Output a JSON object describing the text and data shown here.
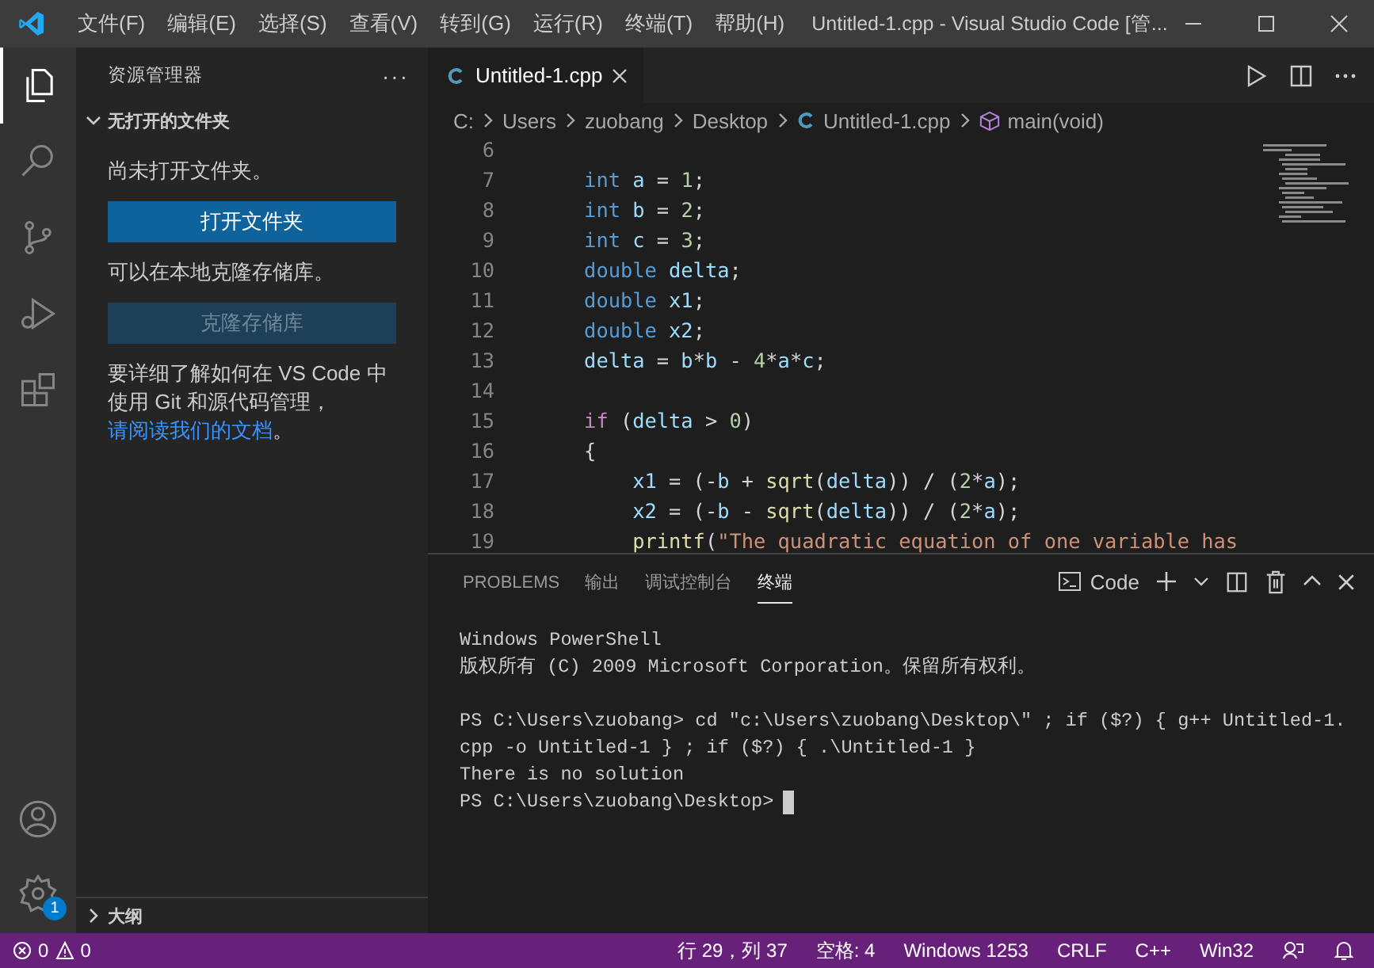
{
  "title_bar": {
    "menus": [
      "文件(F)",
      "编辑(E)",
      "选择(S)",
      "查看(V)",
      "转到(G)",
      "运行(R)",
      "终端(T)",
      "帮助(H)"
    ],
    "title": "Untitled-1.cpp - Visual Studio Code [管..."
  },
  "activity_bar": {
    "items": [
      {
        "kind": "explorer",
        "selected": true
      },
      {
        "kind": "search",
        "selected": false
      },
      {
        "kind": "scm",
        "selected": false
      },
      {
        "kind": "debug",
        "selected": false
      },
      {
        "kind": "extensions",
        "selected": false
      }
    ],
    "settings_badge": "1"
  },
  "sidebar": {
    "title": "资源管理器",
    "more": "···",
    "section": "无打开的文件夹",
    "no_folder_text": "尚未打开文件夹。",
    "open_button": "打开文件夹",
    "clone_text": "可以在本地克隆存储库。",
    "clone_button": {
      "label": "克隆存储库",
      "disabled": true
    },
    "learn_text": "要详细了解如何在 VS Code 中使用 Git 和源代码管理，",
    "learn_link": "请阅读我们的文档",
    "learn_end": "。",
    "outline": "大纲"
  },
  "editor": {
    "tab": {
      "label": "Untitled-1.cpp",
      "selected": true
    },
    "breadcrumb": [
      "C:",
      "Users",
      "zuobang",
      "Desktop",
      "Untitled-1.cpp",
      "main(void)"
    ],
    "lines": [
      {
        "number": "6"
      },
      {
        "number": "7",
        "tokens": [
          {
            "kind": "type",
            "text": "    int"
          },
          {
            "kind": "var",
            "text": " a"
          },
          {
            "kind": "plain",
            "text": " = "
          },
          {
            "kind": "num",
            "text": "1"
          },
          {
            "kind": "plain",
            "text": ";"
          }
        ]
      },
      {
        "number": "8",
        "tokens": [
          {
            "kind": "type",
            "text": "    int"
          },
          {
            "kind": "var",
            "text": " b"
          },
          {
            "kind": "plain",
            "text": " = "
          },
          {
            "kind": "num",
            "text": "2"
          },
          {
            "kind": "plain",
            "text": ";"
          }
        ]
      },
      {
        "number": "9",
        "tokens": [
          {
            "kind": "type",
            "text": "    int"
          },
          {
            "kind": "var",
            "text": " c"
          },
          {
            "kind": "plain",
            "text": " = "
          },
          {
            "kind": "num",
            "text": "3"
          },
          {
            "kind": "plain",
            "text": ";"
          }
        ]
      },
      {
        "number": "10",
        "tokens": [
          {
            "kind": "type",
            "text": "    double"
          },
          {
            "kind": "var",
            "text": " delta"
          },
          {
            "kind": "plain",
            "text": ";"
          }
        ]
      },
      {
        "number": "11",
        "tokens": [
          {
            "kind": "type",
            "text": "    double"
          },
          {
            "kind": "var",
            "text": " x1"
          },
          {
            "kind": "plain",
            "text": ";"
          }
        ]
      },
      {
        "number": "12",
        "tokens": [
          {
            "kind": "type",
            "text": "    double"
          },
          {
            "kind": "var",
            "text": " x2"
          },
          {
            "kind": "plain",
            "text": ";"
          }
        ]
      },
      {
        "number": "13",
        "tokens": [
          {
            "kind": "var",
            "text": "    delta"
          },
          {
            "kind": "plain",
            "text": " = "
          },
          {
            "kind": "var",
            "text": "b"
          },
          {
            "kind": "plain",
            "text": "*"
          },
          {
            "kind": "var",
            "text": "b"
          },
          {
            "kind": "plain",
            "text": " - "
          },
          {
            "kind": "num",
            "text": "4"
          },
          {
            "kind": "plain",
            "text": "*"
          },
          {
            "kind": "var",
            "text": "a"
          },
          {
            "kind": "plain",
            "text": "*"
          },
          {
            "kind": "var",
            "text": "c"
          },
          {
            "kind": "plain",
            "text": ";"
          }
        ]
      },
      {
        "number": "14"
      },
      {
        "number": "15",
        "tokens": [
          {
            "kind": "control",
            "text": "    if"
          },
          {
            "kind": "plain",
            "text": " ("
          },
          {
            "kind": "var",
            "text": "delta"
          },
          {
            "kind": "plain",
            "text": " > "
          },
          {
            "kind": "num",
            "text": "0"
          },
          {
            "kind": "plain",
            "text": ")"
          }
        ]
      },
      {
        "number": "16",
        "tokens": [
          {
            "kind": "plain",
            "text": "    {"
          }
        ]
      },
      {
        "number": "17",
        "tokens": [
          {
            "kind": "var",
            "text": "        x1"
          },
          {
            "kind": "plain",
            "text": " = (-"
          },
          {
            "kind": "var",
            "text": "b"
          },
          {
            "kind": "plain",
            "text": " + "
          },
          {
            "kind": "fn",
            "text": "sqrt"
          },
          {
            "kind": "plain",
            "text": "("
          },
          {
            "kind": "var",
            "text": "delta"
          },
          {
            "kind": "plain",
            "text": ")) / ("
          },
          {
            "kind": "num",
            "text": "2"
          },
          {
            "kind": "plain",
            "text": "*"
          },
          {
            "kind": "var",
            "text": "a"
          },
          {
            "kind": "plain",
            "text": ");"
          }
        ]
      },
      {
        "number": "18",
        "tokens": [
          {
            "kind": "var",
            "text": "        x2"
          },
          {
            "kind": "plain",
            "text": " = (-"
          },
          {
            "kind": "var",
            "text": "b"
          },
          {
            "kind": "plain",
            "text": " - "
          },
          {
            "kind": "fn",
            "text": "sqrt"
          },
          {
            "kind": "plain",
            "text": "("
          },
          {
            "kind": "var",
            "text": "delta"
          },
          {
            "kind": "plain",
            "text": ")) / ("
          },
          {
            "kind": "num",
            "text": "2"
          },
          {
            "kind": "plain",
            "text": "*"
          },
          {
            "kind": "var",
            "text": "a"
          },
          {
            "kind": "plain",
            "text": ");"
          }
        ]
      },
      {
        "number": "19",
        "tokens": [
          {
            "kind": "fn",
            "text": "        printf"
          },
          {
            "kind": "plain",
            "text": "("
          },
          {
            "kind": "str",
            "text": "\"The quadratic equation of one variable has"
          }
        ]
      }
    ]
  },
  "panel": {
    "tabs": [
      {
        "label": "PROBLEMS",
        "selected": false
      },
      {
        "label": "输出",
        "selected": false
      },
      {
        "label": "调试控制台",
        "selected": false
      },
      {
        "label": "终端",
        "selected": true
      }
    ],
    "terminal_name": "Code",
    "terminal_blocks": [
      [
        "Windows PowerShell",
        "版权所有 (C) 2009 Microsoft Corporation。保留所有权利。"
      ],
      [
        "PS C:\\Users\\zuobang> cd \"c:\\Users\\zuobang\\Desktop\\\" ; if ($?) { g++ Untitled-1.",
        "cpp -o Untitled-1 } ; if ($?) { .\\Untitled-1 }",
        "There is no solution"
      ]
    ],
    "prompt": "PS C:\\Users\\zuobang\\Desktop>"
  },
  "status_bar": {
    "errors": "0",
    "warnings": "0",
    "items": [
      "行 29，列 37",
      "空格: 4",
      "Windows 1253",
      "CRLF",
      "C++",
      "Win32"
    ]
  }
}
